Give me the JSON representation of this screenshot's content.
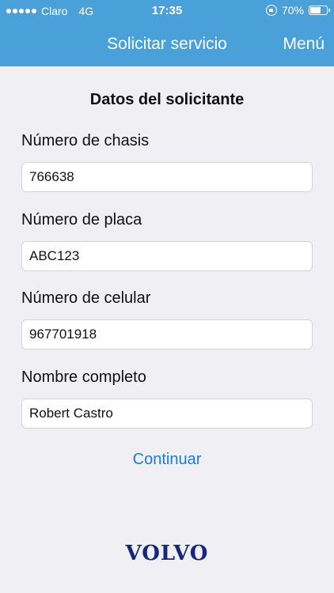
{
  "status_bar": {
    "carrier": "Claro",
    "network": "4G",
    "time": "17:35",
    "battery_percent": "70%",
    "battery_level": 0.7,
    "signal_dots": 5,
    "icons": [
      "signal-icon",
      "rotation-lock-icon",
      "battery-icon"
    ]
  },
  "nav": {
    "title": "Solicitar servicio",
    "menu_label": "Menú"
  },
  "form": {
    "section_title": "Datos del solicitante",
    "fields": [
      {
        "label": "Número de chasis",
        "value": "766638"
      },
      {
        "label": "Número de placa",
        "value": "ABC123"
      },
      {
        "label": "Número de celular",
        "value": "967701918"
      },
      {
        "label": "Nombre completo",
        "value": "Robert Castro"
      }
    ],
    "continue_label": "Continuar"
  },
  "footer": {
    "logo_text": "VOLVO"
  },
  "colors": {
    "header_bg": "#4aa0d8",
    "link": "#1a7ce0",
    "logo": "#17277a",
    "page_bg": "#efeff4"
  }
}
